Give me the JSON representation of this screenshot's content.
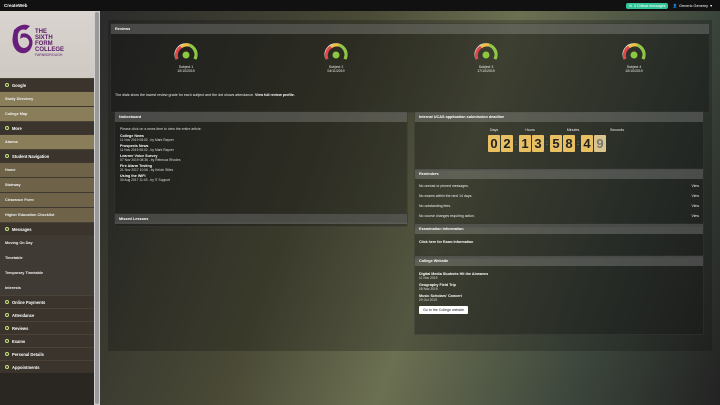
{
  "app": {
    "title": "CreateWeb"
  },
  "topbar": {
    "messages_label": "0 Critical messages",
    "user_name": "Generic Generny"
  },
  "logo": {
    "line1": "THE",
    "line2": "SIXTH",
    "line3": "FORM",
    "line4": "COLLEGE",
    "line5": "FARNBOROUGH"
  },
  "sidebar": {
    "sections": [
      {
        "label": "Google",
        "items": [
          "Study Directory",
          "College Map"
        ]
      },
      {
        "label": "More",
        "items": [
          "Alarms"
        ]
      },
      {
        "label": "Student Navigation",
        "items": [
          "Home",
          "Stairway",
          "Clearance Form",
          "Higher Education Checklist"
        ]
      },
      {
        "label": "Messages",
        "items": [
          "Moving On Day",
          "Timetable",
          "Temporary Timetable",
          "Interests"
        ]
      }
    ],
    "bottom": [
      "Online Payments",
      "Attendance",
      "Reviews",
      "Exams",
      "Personal Details",
      "Appointments"
    ]
  },
  "reviews": {
    "title": "Reviews",
    "subjects": [
      {
        "name": "Subject 1",
        "date": "10/10/2019"
      },
      {
        "name": "Subject 2",
        "date": "04/11/2019"
      },
      {
        "name": "Subject 3",
        "date": "17/10/2019"
      },
      {
        "name": "Subject 4",
        "date": "10/10/2019"
      }
    ],
    "note": "The dials show the lowest review grade for each subject and the dot shows attendance.",
    "link": "View full review profile."
  },
  "noticeboard": {
    "title": "Noticeboard",
    "intro": "Please click on a news item to view the entire article.",
    "items": [
      {
        "title": "College News",
        "meta": "11 Nov 2019 08:02 - by Mark Rayner"
      },
      {
        "title": "Prospects News",
        "meta": "11 Nov 2019 08:02 - by Mark Rayner"
      },
      {
        "title": "Learner Voice Survey",
        "meta": "07 Nov 2019 08:36 - by Rebecca Rhodes"
      },
      {
        "title": "Fire Alarm Testing",
        "meta": "21 Nov 2017 10:06 - by Kelvin Stiles"
      },
      {
        "title": "Using the WiFi",
        "meta": "30 Aug 2017 11:43 - by IT Support"
      }
    ]
  },
  "missed": {
    "title": "Missed Lessons"
  },
  "ucas": {
    "title": "Internal UCAS application submission deadline",
    "labels": {
      "days": "Days",
      "hours": "Hours",
      "minutes": "Minutes",
      "seconds": "Seconds"
    },
    "digits": {
      "d1": "0",
      "d2": "2",
      "h1": "1",
      "h2": "3",
      "m1": "5",
      "m2": "8",
      "s1": "4",
      "s2": "9"
    }
  },
  "reminders": {
    "title": "Reminders",
    "rows": [
      {
        "text": "No unread or pinned messages.",
        "action": "View"
      },
      {
        "text": "No exams within the next 14 days.",
        "action": "View"
      },
      {
        "text": "No outstanding fees.",
        "action": "View"
      },
      {
        "text": "No course changes requiring action.",
        "action": "View"
      }
    ]
  },
  "exam": {
    "title": "Examination Information",
    "link": "Click here for Exam Information"
  },
  "website": {
    "title": "College Website",
    "items": [
      {
        "title": "Digital Media Students Hit the Airwaves",
        "date": "11 Nov 2019"
      },
      {
        "title": "Geography Field Trip",
        "date": "08 Nov 2019"
      },
      {
        "title": "Music Scholars' Concert",
        "date": "29 Oct 2019"
      }
    ],
    "button": "Go to the College website"
  }
}
